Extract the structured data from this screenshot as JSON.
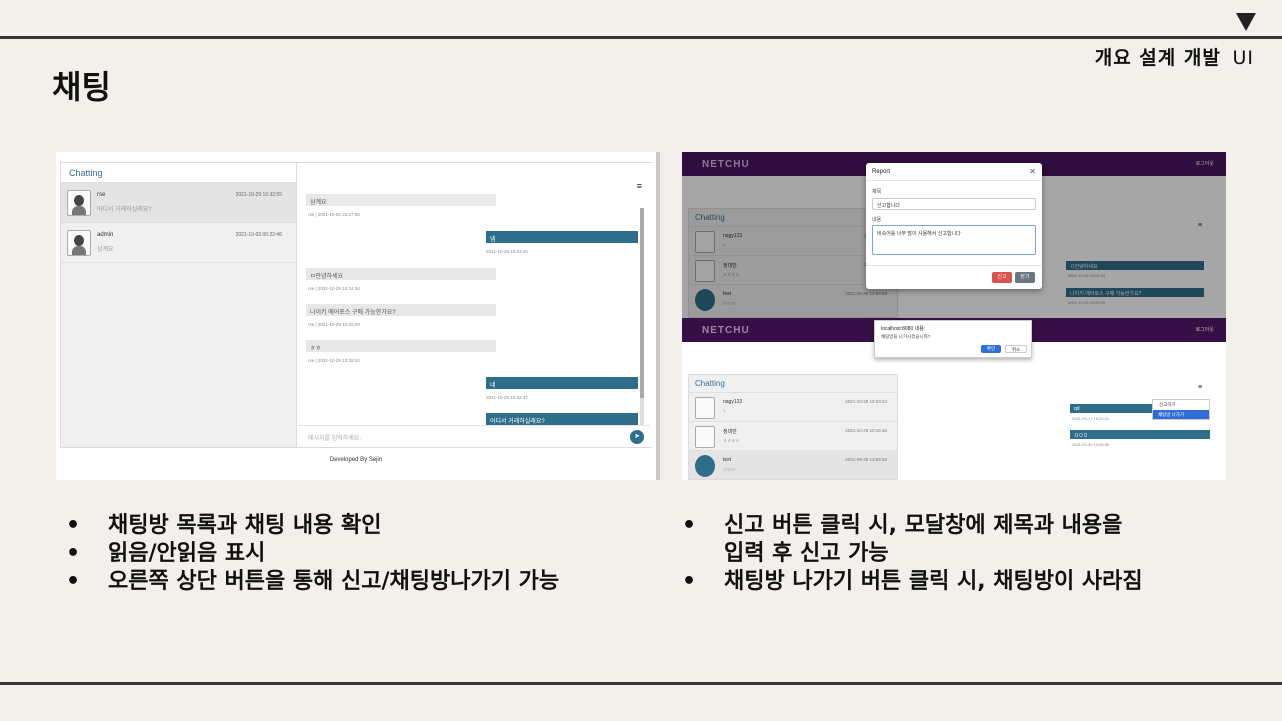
{
  "header": {
    "breadcrumb_main": "개요 설계 개발",
    "breadcrumb_ui": "UI",
    "title": "채팅"
  },
  "left_shot": {
    "chat_title": "Chatting",
    "rooms": [
      {
        "name": "rse",
        "preview": "어디서 거래하실래요?",
        "time": "2021-10-29 10:32:55"
      },
      {
        "name": "admin",
        "preview": "삼계요",
        "time": "2021-10-03 00:22:46"
      }
    ],
    "messages": [
      {
        "dir": "in",
        "text": "삼계요",
        "meta": "rse | 2021-10-02 23:27:55"
      },
      {
        "dir": "out",
        "text": "넵",
        "meta": "2021-10-29 10:23:16"
      },
      {
        "dir": "in",
        "text": "ㅁ안녕하세요",
        "meta": "rse | 2021-10-29 10:24:34"
      },
      {
        "dir": "in",
        "text": "나이키 에어포스 구매 가능한가요?",
        "meta": "rse | 2021-10-29 10:28:29"
      },
      {
        "dir": "in",
        "text": "ㅎㅎ",
        "meta": "rse | 2021-10-29 10:29:10"
      },
      {
        "dir": "out",
        "text": "네",
        "meta": "2021-10-29 10:32:47"
      },
      {
        "dir": "out",
        "text": "어디서 거래하실래요?",
        "meta": ""
      }
    ],
    "input_placeholder": "메시지를 입력하세요.",
    "footer": "Developed By Sejin"
  },
  "right_shot": {
    "logo": "NETCHU",
    "logout": "로그아웃",
    "chat_title": "Chatting",
    "rooms_top": [
      {
        "name": "nagy123",
        "preview": "?",
        "time": "2021-10-28"
      },
      {
        "name": "정대만",
        "preview": "ㅎㅎㅎㅎ",
        "time": "2021-10-28"
      },
      {
        "name": "test",
        "preview": "ㅁㅁㅁ",
        "time": "2021-09-30 13:59:59"
      }
    ],
    "modal": {
      "title": "Report",
      "subject_label": "제목",
      "subject_value": "신고합니다",
      "content_label": "내용",
      "content_value": "비속어를 너무 많이 사용해서 신고합니다",
      "report_button": "신고",
      "close_button": "닫기"
    },
    "top_bubbles": [
      {
        "text": "ㅁ안녕하세요",
        "meta": "2021-10-29 10:24:34"
      },
      {
        "text": "나이키 에어포스 구매 가능한가요?",
        "meta": "2021-10-29 10:28:29"
      }
    ],
    "alert": {
      "origin": "localhost:8080 내용:",
      "message": "채팅방을 나가시겠습니까?",
      "ok": "확인",
      "cancel": "취소"
    },
    "rooms_bottom": [
      {
        "name": "nagy123",
        "preview": "?",
        "time": "2021-10-29 10:23:24"
      },
      {
        "name": "정대만",
        "preview": "ㅎㅎㅎㅎ",
        "time": "2021-10-29 10:16:46"
      },
      {
        "name": "test",
        "preview": "ㅁㅁㅁ",
        "time": "2021-09-30 13:59:59"
      }
    ],
    "dropdown": {
      "report": "신고하기",
      "leave": "채팅방 나가기"
    },
    "bottom_bubbles": [
      {
        "text": "qd",
        "meta": "2021-09-17 16:20:21"
      },
      {
        "text": "ㅁㅁㅁ",
        "meta": "2021-09-30 13:59:59"
      }
    ]
  },
  "bullets_left": [
    "채팅방 목록과 채팅 내용 확인",
    "읽음/안읽음 표시",
    "오른쪽 상단 버튼을 통해 신고/채팅방나가기 가능"
  ],
  "bullets_right": {
    "item1_line1": "신고 버튼 클릭 시, 모달창에 제목과 내용을",
    "item1_line2": "입력 후 신고 가능",
    "item2": "채팅방 나가기 버튼 클릭 시, 채팅방이 사라짐"
  }
}
